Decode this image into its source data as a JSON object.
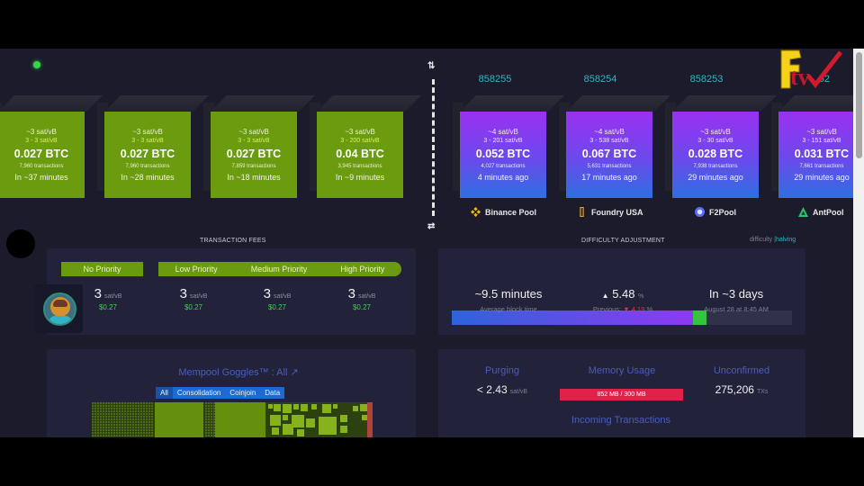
{
  "pending_blocks": [
    {
      "median_fee": "~3 sat/vB",
      "fee_range": "3 - 3 sat/vB",
      "total": "0.027 BTC",
      "tx_count": "7,960 transactions",
      "eta": "In ~37 minutes"
    },
    {
      "median_fee": "~3 sat/vB",
      "fee_range": "3 - 3 sat/vB",
      "total": "0.027 BTC",
      "tx_count": "7,960 transactions",
      "eta": "In ~28 minutes"
    },
    {
      "median_fee": "~3 sat/vB",
      "fee_range": "3 - 3 sat/vB",
      "total": "0.027 BTC",
      "tx_count": "7,859 transactions",
      "eta": "In ~18 minutes"
    },
    {
      "median_fee": "~3 sat/vB",
      "fee_range": "3 - 200 sat/vB",
      "total": "0.04 BTC",
      "tx_count": "3,945 transactions",
      "eta": "In ~9 minutes"
    }
  ],
  "mined_blocks": [
    {
      "height": "858255",
      "median_fee": "~4 sat/vB",
      "fee_range": "3 - 201 sat/vB",
      "total": "0.052 BTC",
      "tx_count": "4,027 transactions",
      "age": "4 minutes ago",
      "pool": "Binance Pool",
      "pool_icon": "binance-icon"
    },
    {
      "height": "858254",
      "median_fee": "~4 sat/vB",
      "fee_range": "3 - 538 sat/vB",
      "total": "0.067 BTC",
      "tx_count": "5,631 transactions",
      "age": "17 minutes ago",
      "pool": "Foundry USA",
      "pool_icon": "foundry-icon"
    },
    {
      "height": "858253",
      "median_fee": "~3 sat/vB",
      "fee_range": "3 - 30 sat/vB",
      "total": "0.028 BTC",
      "tx_count": "7,938 transactions",
      "age": "29 minutes ago",
      "pool": "F2Pool",
      "pool_icon": "f2pool-icon"
    },
    {
      "height": "...52",
      "median_fee": "~3 sat/vB",
      "fee_range": "3 - 151 sat/vB",
      "total": "0.031 BTC",
      "tx_count": "7,661 transactions",
      "age": "29 minutes ago",
      "pool": "AntPool",
      "pool_icon": "antpool-icon"
    }
  ],
  "transaction_fees": {
    "title": "Transaction Fees",
    "tiers": [
      {
        "label": "No Priority",
        "value": "3",
        "unit": "sat/vB",
        "usd": "$0.27"
      },
      {
        "label": "Low Priority",
        "value": "3",
        "unit": "sat/vB",
        "usd": "$0.27"
      },
      {
        "label": "Medium Priority",
        "value": "3",
        "unit": "sat/vB",
        "usd": "$0.27"
      },
      {
        "label": "High Priority",
        "value": "3",
        "unit": "sat/vB",
        "usd": "$0.27"
      }
    ]
  },
  "difficulty": {
    "title": "Difficulty Adjustment",
    "toggle_prefix": "difficulty |",
    "toggle_active": "halving",
    "progress_pct": 71,
    "green_pct": 4,
    "avg_block_time": "~9.5 minutes",
    "avg_block_time_label": "Average block time",
    "change_arrow": "▲",
    "change": "5.48",
    "change_unit": "%",
    "previous_label": "Previous:",
    "previous_value": "▼ 4.19",
    "previous_unit": "%",
    "eta": "In ~3 days",
    "eta_date": "August 28 at 8:45 AM"
  },
  "goggles": {
    "title": "Mempool Goggles™ : All",
    "tabs": [
      "All",
      "Consolidation",
      "Coinjoin",
      "Data"
    ],
    "active_tab": "All"
  },
  "mempool": {
    "purging_label": "Purging",
    "purging_value": "< 2.43",
    "purging_unit": "sat/vB",
    "memory_label": "Memory Usage",
    "memory_value": "852 MB / 300 MB",
    "unconfirmed_label": "Unconfirmed",
    "unconfirmed_value": "275,206",
    "unconfirmed_unit": "TXs",
    "incoming_label": "Incoming Transactions"
  },
  "colors": {
    "pending_block": "#6b9b0f",
    "mined_block_top": "#9a31f0",
    "mined_block_bottom": "#2e6fe0",
    "accent_teal": "#2eb7c4",
    "positive": "#3bd44a",
    "negative": "#e0304f"
  }
}
